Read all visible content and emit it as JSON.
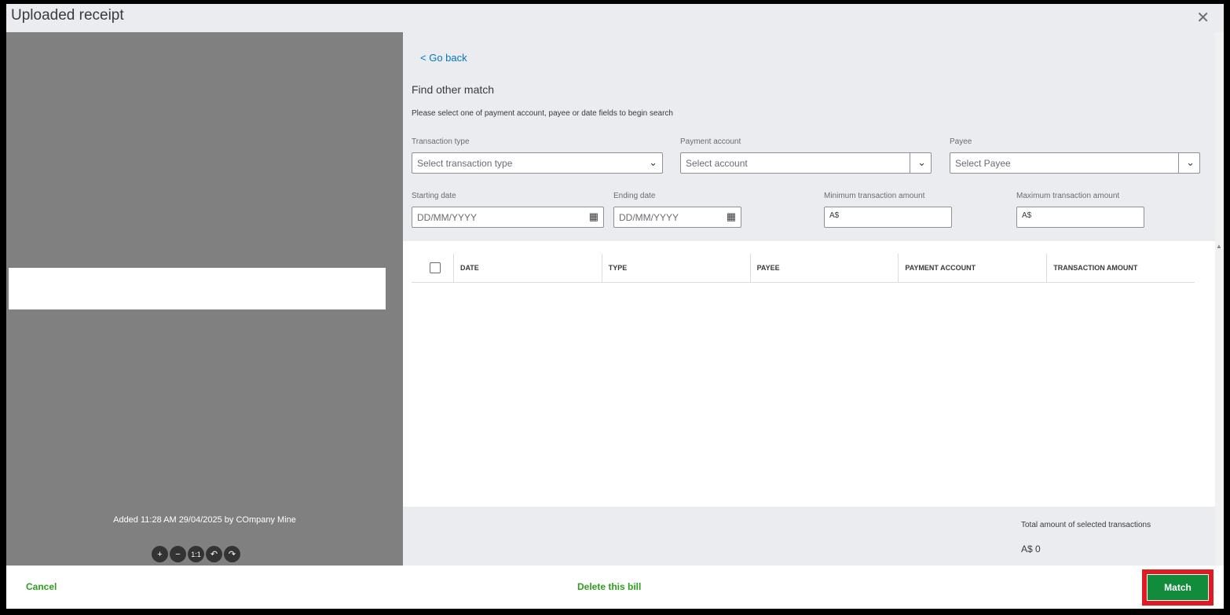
{
  "dialog": {
    "title": "Uploaded receipt",
    "close": "✕"
  },
  "preview": {
    "added": "Added 11:28 AM 29/04/2025 by COmpany Mine",
    "tools": [
      "+",
      "−",
      "1:1",
      "↶",
      "↷"
    ]
  },
  "search": {
    "go_back": "< Go back",
    "heading": "Find other match",
    "hint": "Please select one of payment account, payee or date fields to begin search",
    "transaction_type": {
      "label": "Transaction type",
      "placeholder": "Select transaction type"
    },
    "payment_account": {
      "label": "Payment account",
      "placeholder": "Select account"
    },
    "payee": {
      "label": "Payee",
      "placeholder": "Select Payee"
    },
    "start_date": {
      "label": "Starting date",
      "placeholder": "DD/MM/YYYY"
    },
    "end_date": {
      "label": "Ending date",
      "placeholder": "DD/MM/YYYY"
    },
    "min_amount": {
      "label": "Minimum transaction amount",
      "prefix": "A$"
    },
    "max_amount": {
      "label": "Maximum transaction amount",
      "prefix": "A$"
    }
  },
  "table": {
    "columns": [
      "DATE",
      "TYPE",
      "PAYEE",
      "PAYMENT ACCOUNT",
      "TRANSACTION AMOUNT"
    ],
    "rows": []
  },
  "summary": {
    "label": "Total amount of selected transactions",
    "value": "A$ 0"
  },
  "footer": {
    "cancel": "Cancel",
    "delete": "Delete this bill",
    "match": "Match"
  }
}
